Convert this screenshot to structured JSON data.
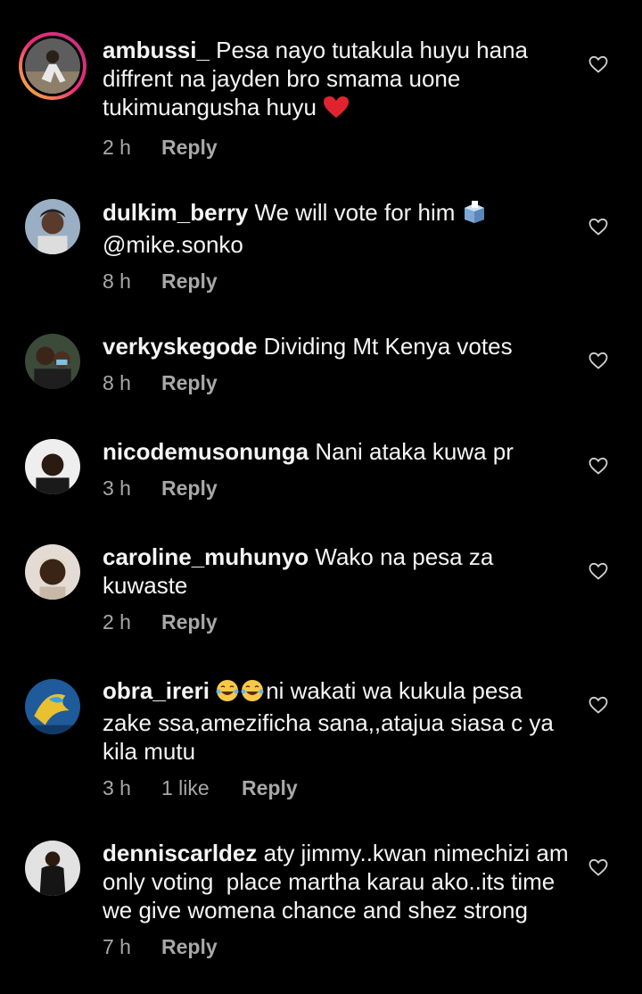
{
  "comments": [
    {
      "username": "ambussi_",
      "text": " Pesa nayo tutakula huyu hana diffrent na jayden bro smama uone tukimuangusha huyu ",
      "trailing_emoji": "red-heart-emoji",
      "time": "2 h",
      "likes": "",
      "reply": "Reply",
      "avatar_color": "#6b6b6b",
      "has_story_ring": true
    },
    {
      "username": "dulkim_berry",
      "text": " We will vote for him ",
      "trailing_emoji": "ballot-box-emoji",
      "mention": "@mike.sonko",
      "time": "8 h",
      "likes": "",
      "reply": "Reply",
      "avatar_color": "#8a9bb0"
    },
    {
      "username": "verkyskegode",
      "text": " Dividing Mt Kenya votes",
      "time": "8 h",
      "likes": "",
      "reply": "Reply",
      "avatar_color": "#4a5a4a"
    },
    {
      "username": "nicodemusonunga",
      "text": " Nani ataka kuwa pr",
      "time": "3 h",
      "likes": "",
      "reply": "Reply",
      "avatar_color": "#e8e8e8"
    },
    {
      "username": "caroline_muhunyo",
      "text": " Wako na pesa za kuwaste",
      "time": "2 h",
      "likes": "",
      "reply": "Reply",
      "avatar_color": "#d9cfc8"
    },
    {
      "username": "obra_ireri",
      "leading_emoji": "laughing-tears-emoji",
      "text": "ni wakati wa kukula pesa zake ssa,amezificha sana,,atajua siasa c ya kila mutu",
      "time": "3 h",
      "likes": "1 like",
      "reply": "Reply",
      "avatar_color": "#2a6fb0"
    },
    {
      "username": "denniscarldez",
      "text": " aty jimmy..kwan nimechizi am only voting  place martha karau ako..its time we give womena chance and shez strong",
      "time": "7 h",
      "likes": "",
      "reply": "Reply",
      "avatar_color": "#d8d8d8"
    }
  ],
  "colors": {
    "background": "#000000",
    "primary_text": "#f5f5f5",
    "secondary_text": "#a8a8a8",
    "heart_outline": "#d0d0d0"
  },
  "icons": {
    "like": "heart-outline-icon"
  }
}
